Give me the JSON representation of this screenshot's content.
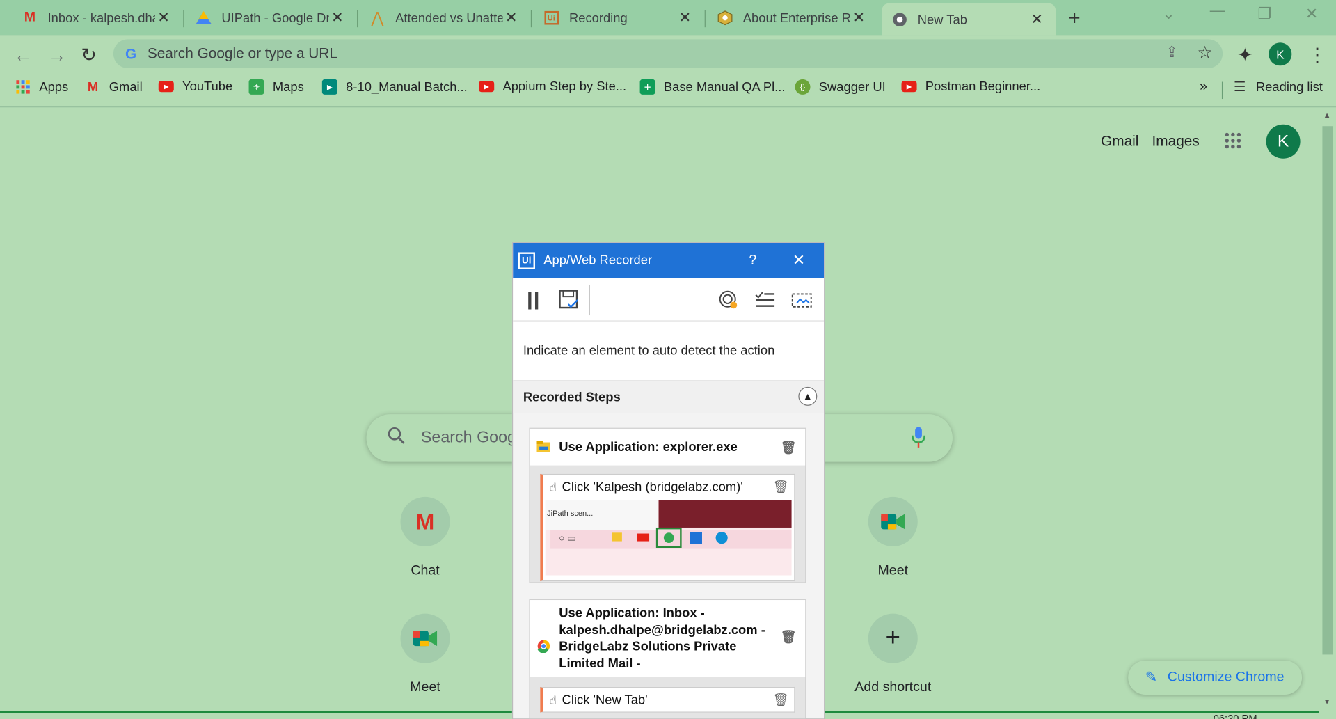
{
  "browser": {
    "tabs": [
      {
        "title": "Inbox - kalpesh.dha",
        "icon": "gmail-icon"
      },
      {
        "title": "UIPath - Google Dri",
        "icon": "google-drive-icon"
      },
      {
        "title": "Attended vs Unatte",
        "icon": "article-icon"
      },
      {
        "title": "Recording",
        "icon": "uipath-icon"
      },
      {
        "title": "About Enterprise Ri",
        "icon": "enterprise-icon"
      },
      {
        "title": "New Tab",
        "icon": "chrome-icon"
      }
    ],
    "omnibox_placeholder": "Search Google or type a URL",
    "profile_initial": "K",
    "bookmarks": [
      {
        "label": "Apps",
        "icon": "apps-grid-icon"
      },
      {
        "label": "Gmail",
        "icon": "gmail-icon"
      },
      {
        "label": "YouTube",
        "icon": "youtube-icon"
      },
      {
        "label": "Maps",
        "icon": "maps-icon"
      },
      {
        "label": "8-10_Manual Batch...",
        "icon": "meet-icon"
      },
      {
        "label": "Appium Step by Ste...",
        "icon": "youtube-icon"
      },
      {
        "label": "Base Manual QA Pl...",
        "icon": "sheets-icon"
      },
      {
        "label": "Swagger UI",
        "icon": "swagger-icon"
      },
      {
        "label": "Postman Beginner...",
        "icon": "youtube-icon"
      }
    ],
    "more_bookmarks": "»",
    "reading_list": "Reading list"
  },
  "ntp": {
    "gmail_link": "Gmail",
    "images_link": "Images",
    "avatar_initial": "K",
    "search_placeholder": "Search Goog",
    "shortcuts": [
      {
        "label": "Chat",
        "icon": "gmail-icon"
      },
      {
        "label": "Meet",
        "icon": "meet-icon"
      },
      {
        "label": "Meet",
        "icon": "meet-icon"
      },
      {
        "label": "Add shortcut",
        "icon": "plus-icon"
      }
    ],
    "customize_label": "Customize Chrome",
    "clock_partial": "06:20 PM"
  },
  "recorder": {
    "title": "App/Web Recorder",
    "help": "?",
    "message": "Indicate an element to auto detect the action",
    "recorded_steps_label": "Recorded Steps",
    "groups": [
      {
        "title": "Use Application: explorer.exe",
        "steps": [
          {
            "label": "Click 'Kalpesh (bridgelabz.com)'",
            "thumb_text": "JiPath scen..."
          }
        ]
      },
      {
        "title": "Use Application: Inbox - kalpesh.dhalpe@bridgelabz.com - BridgeLabz Solutions Private Limited Mail -",
        "steps": [
          {
            "label": "Click 'New Tab'"
          }
        ]
      }
    ]
  },
  "colors": {
    "page_bg": "#b4dcb4",
    "tabbar_bg": "#97cfa5",
    "recorder_title_bg": "#1f72d6",
    "accent_blue": "#1a73e8",
    "step_accent": "#f07c4f"
  }
}
